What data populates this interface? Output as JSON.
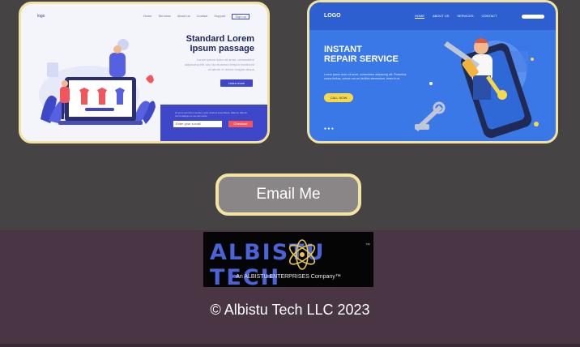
{
  "card1": {
    "logo": "logo",
    "nav": [
      "Home",
      "Services",
      "About us",
      "Contact",
      "Support",
      "Sign up"
    ],
    "title_line1": "Standard Lorem",
    "title_line2": "Ipsum passage",
    "subtitle": "Lorem ipsum dolor sit amet, consectetur adipiscing elit, sed do eiusmod tempor incididunt ut labore et dolore magna aliqua",
    "button": "Learn more",
    "band_text": "Ut enim ad minim veniam, quis nostrud exercitation ullamco laboris nisi ut aliquip ex ea commodo",
    "input_placeholder": "Enter your e-mail",
    "input_button": "Checkout"
  },
  "card2": {
    "logo": "LOGO",
    "nav": [
      "HOME",
      "ABOUT US",
      "SERVICES",
      "CONTACT"
    ],
    "title_line1": "INSTANT",
    "title_line2": "REPAIR SERVICE",
    "subtitle": "Lorem ipsum dolor sit amet, consectetur adipiscing elit. Phasellus varius finibus, cursus non eu facilisis elementum, lorem in et.",
    "button": "CALL NOW",
    "social": "● ● ●"
  },
  "email_button": "Email Me",
  "footer": {
    "logo_text": "ALBISTU TECH",
    "logo_tm": "™",
    "logo_sub": "An ALBISTU ENTERPRISES Company™",
    "copyright": "© Albistu Tech LLC 2023"
  }
}
